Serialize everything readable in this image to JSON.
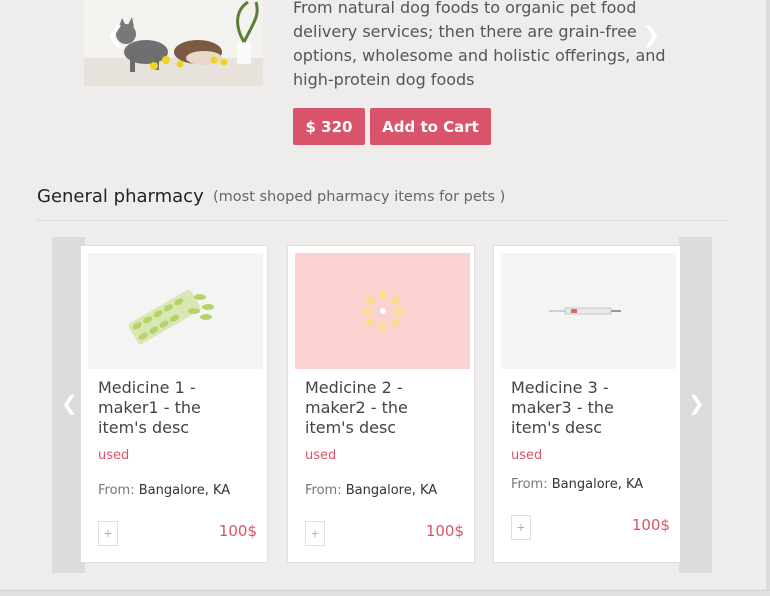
{
  "featured": {
    "description": "From natural dog foods to organic pet food delivery services; then there are grain-free options, wholesome and holistic offerings, and high-protein dog foods",
    "price_label": "$ 320",
    "cart_label": "Add to Cart",
    "prev_icon": "chevron-left-icon",
    "next_icon": "chevron-right-icon"
  },
  "section": {
    "title": "General pharmacy",
    "subtitle": "(most shoped pharmacy items for pets )"
  },
  "carousel": {
    "prev_icon": "chevron-left-icon",
    "next_icon": "chevron-right-icon"
  },
  "products": [
    {
      "title": "Medicine 1 - maker1 - the item's desc",
      "condition": "used",
      "from_label": "From:",
      "location": "Bangalore, KA",
      "add_label": "+",
      "price": "100$"
    },
    {
      "title": "Medicine 2 - maker2 - the item's desc",
      "condition": "used",
      "from_label": "From:",
      "location": "Bangalore, KA",
      "add_label": "+",
      "price": "100$"
    },
    {
      "title": "Medicine 3 - maker3 - the item's desc",
      "condition": "used",
      "from_label": "From:",
      "location": "Bangalore, KA",
      "add_label": "+",
      "price": "100$"
    }
  ],
  "colors": {
    "accent": "#d9536b",
    "background": "#efedeb",
    "card_image_bg_1": "#f4f4f4",
    "card_image_bg_2": "#fbd2d0",
    "card_image_bg_3": "#f4f4f4"
  }
}
